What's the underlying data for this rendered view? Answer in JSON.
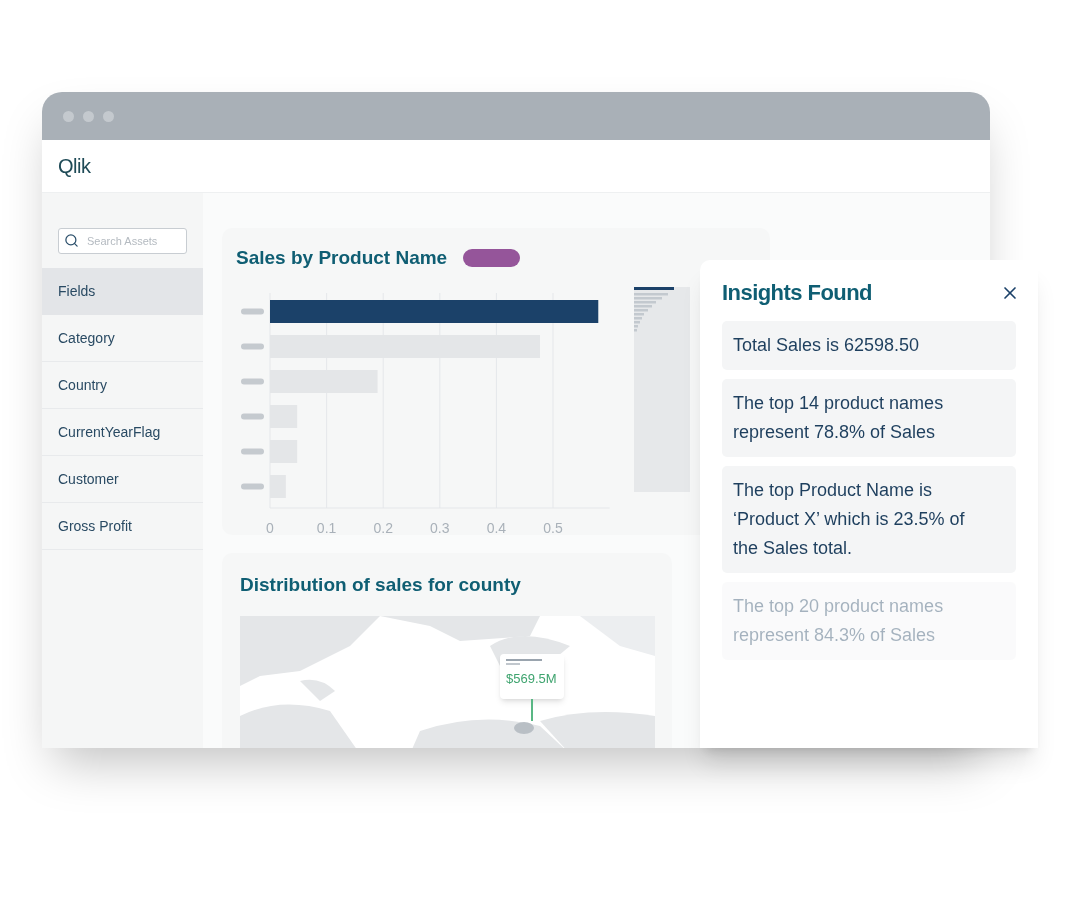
{
  "header": {
    "logo": "Qlik"
  },
  "sidebar": {
    "search": {
      "placeholder": "Search Assets"
    },
    "items": [
      {
        "label": "Fields",
        "selected": true
      },
      {
        "label": "Category",
        "selected": false
      },
      {
        "label": "Country",
        "selected": false
      },
      {
        "label": "CurrentYearFlag",
        "selected": false
      },
      {
        "label": "Customer",
        "selected": false
      },
      {
        "label": "Gross Profit",
        "selected": false
      }
    ]
  },
  "sales_chart": {
    "title": "Sales by Product Name",
    "chart_data": {
      "type": "bar",
      "orientation": "horizontal",
      "stacked": true,
      "grid": true,
      "xlim": [
        0,
        0.6
      ],
      "xticks": [
        0,
        0.1,
        0.2,
        0.3,
        0.4,
        0.5
      ],
      "series": [
        {
          "color": "#1b4169",
          "values": [
            0.58,
            null,
            null,
            null,
            null,
            null
          ]
        },
        {
          "color": "#e4e6e8",
          "values": [
            null,
            0.477,
            0.19,
            0.048,
            0.048,
            0.028
          ]
        }
      ]
    }
  },
  "map_card": {
    "title": "Distribution of sales for county",
    "tooltip": {
      "value": "$569.5M"
    }
  },
  "insights": {
    "title": "Insights Found",
    "items": [
      {
        "text": "Total Sales is 62598.50",
        "faded": false
      },
      {
        "text": "The top 14 product names represent 78.8% of Sales",
        "faded": false
      },
      {
        "text": "The top Product Name is ‘Product X’ which is 23.5% of the Sales total.",
        "faded": false
      },
      {
        "text": "The top 20 product names represent 84.3% of Sales",
        "faded": true
      }
    ]
  }
}
